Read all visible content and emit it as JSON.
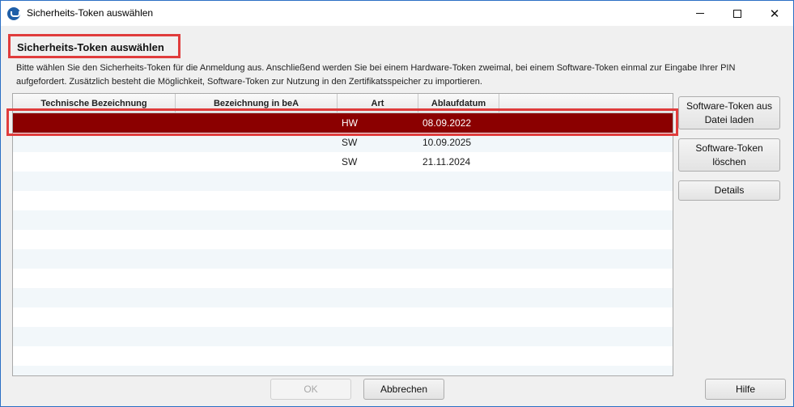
{
  "window": {
    "title": "Sicherheits-Token auswählen",
    "icon": "app-logo-icon",
    "controls": {
      "minimize": "minimize-icon",
      "maximize": "maximize-icon",
      "close": "close-icon"
    }
  },
  "heading": "Sicherheits-Token auswählen",
  "description": "Bitte wählen Sie den Sicherheits-Token für die Anmeldung aus. Anschließend werden Sie bei einem Hardware-Token zweimal, bei einem Software-Token einmal zur Eingabe Ihrer PIN aufgefordert. Zusätzlich besteht die Möglichkeit, Software-Token zur Nutzung in den Zertifikatsspeicher zu importieren.",
  "table": {
    "columns": [
      "Technische Bezeichnung",
      "Bezeichnung in beA",
      "Art",
      "Ablaufdatum"
    ],
    "rows": [
      {
        "technical": "",
        "bea_name": "",
        "type": "HW",
        "expiry": "08.09.2022",
        "selected": true
      },
      {
        "technical": "",
        "bea_name": "",
        "type": "SW",
        "expiry": "10.09.2025",
        "selected": false
      },
      {
        "technical": "",
        "bea_name": "",
        "type": "SW",
        "expiry": "21.11.2024",
        "selected": false
      }
    ]
  },
  "buttons": {
    "load_software_token": "Software-Token aus Datei laden",
    "delete_software_token": "Software-Token löschen",
    "details": "Details",
    "ok": "OK",
    "cancel": "Abbrechen",
    "help": "Hilfe"
  },
  "colors": {
    "selection": "#8b0000",
    "highlight_outline": "#e03c3c"
  }
}
